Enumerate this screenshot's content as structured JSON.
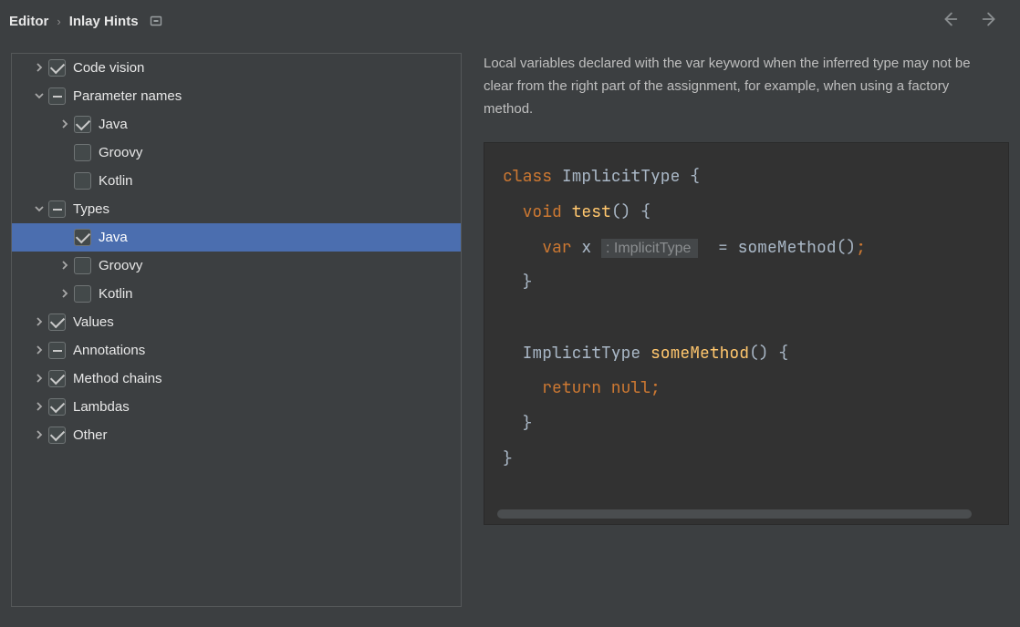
{
  "breadcrumb": {
    "parent": "Editor",
    "current": "Inlay Hints"
  },
  "tree": [
    {
      "label": "Code vision",
      "depth": 0,
      "toggle": "collapsed",
      "state": "checked",
      "selected": false
    },
    {
      "label": "Parameter names",
      "depth": 0,
      "toggle": "expanded",
      "state": "indet",
      "selected": false
    },
    {
      "label": "Java",
      "depth": 1,
      "toggle": "collapsed",
      "state": "checked",
      "selected": false
    },
    {
      "label": "Groovy",
      "depth": 1,
      "toggle": "none",
      "state": "unchecked",
      "selected": false
    },
    {
      "label": "Kotlin",
      "depth": 1,
      "toggle": "none",
      "state": "unchecked",
      "selected": false
    },
    {
      "label": "Types",
      "depth": 0,
      "toggle": "expanded",
      "state": "indet",
      "selected": false
    },
    {
      "label": "Java",
      "depth": 1,
      "toggle": "none",
      "state": "checked",
      "selected": true
    },
    {
      "label": "Groovy",
      "depth": 1,
      "toggle": "collapsed",
      "state": "unchecked",
      "selected": false
    },
    {
      "label": "Kotlin",
      "depth": 1,
      "toggle": "collapsed",
      "state": "unchecked",
      "selected": false
    },
    {
      "label": "Values",
      "depth": 0,
      "toggle": "collapsed",
      "state": "checked",
      "selected": false
    },
    {
      "label": "Annotations",
      "depth": 0,
      "toggle": "collapsed",
      "state": "indet",
      "selected": false
    },
    {
      "label": "Method chains",
      "depth": 0,
      "toggle": "collapsed",
      "state": "checked",
      "selected": false
    },
    {
      "label": "Lambdas",
      "depth": 0,
      "toggle": "collapsed",
      "state": "checked",
      "selected": false
    },
    {
      "label": "Other",
      "depth": 0,
      "toggle": "collapsed",
      "state": "checked",
      "selected": false
    }
  ],
  "description_text": "Local variables declared with the var keyword when the inferred type may not be clear from the right part of the assignment, for example, when using a factory method.",
  "code": {
    "lines": [
      {
        "tokens": [
          {
            "t": "class ",
            "c": "kw"
          },
          {
            "t": "ImplicitType ",
            "c": "id"
          },
          {
            "t": "{",
            "c": "pc"
          }
        ]
      },
      {
        "tokens": [
          {
            "t": "  ",
            "c": "id"
          },
          {
            "t": "void ",
            "c": "kw"
          },
          {
            "t": "test",
            "c": "mth"
          },
          {
            "t": "() {",
            "c": "pc"
          }
        ]
      },
      {
        "tokens": [
          {
            "t": "    ",
            "c": "id"
          },
          {
            "t": "var ",
            "c": "kw"
          },
          {
            "t": "x ",
            "c": "id"
          },
          {
            "t": ": ImplicitType",
            "c": "hint"
          },
          {
            "t": "  = someMethod()",
            "c": "id"
          },
          {
            "t": ";",
            "c": "sc"
          }
        ]
      },
      {
        "tokens": [
          {
            "t": "  }",
            "c": "pc"
          }
        ]
      },
      {
        "tokens": [
          {
            "t": " ",
            "c": "id"
          }
        ]
      },
      {
        "tokens": [
          {
            "t": "  ImplicitType ",
            "c": "id"
          },
          {
            "t": "someMethod",
            "c": "mth"
          },
          {
            "t": "() {",
            "c": "pc"
          }
        ]
      },
      {
        "tokens": [
          {
            "t": "    ",
            "c": "id"
          },
          {
            "t": "return null",
            "c": "kw"
          },
          {
            "t": ";",
            "c": "sc"
          }
        ]
      },
      {
        "tokens": [
          {
            "t": "  }",
            "c": "pc"
          }
        ]
      },
      {
        "tokens": [
          {
            "t": "}",
            "c": "pc"
          }
        ]
      }
    ]
  }
}
